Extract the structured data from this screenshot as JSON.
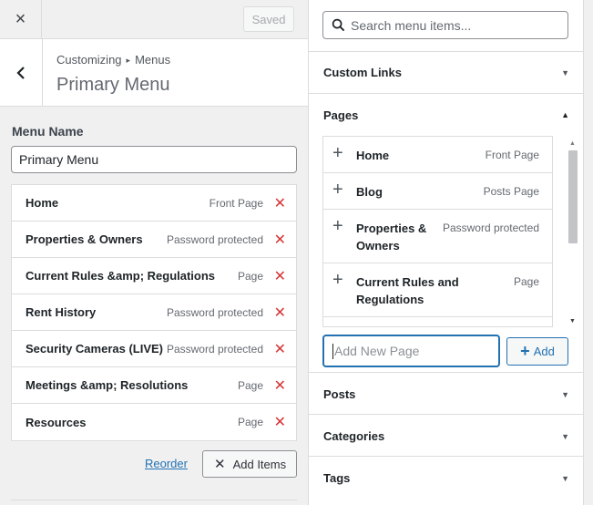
{
  "topbar": {
    "close_icon": "×",
    "saved_label": "Saved"
  },
  "header": {
    "breadcrumb_root": "Customizing",
    "breadcrumb_sep": "▸",
    "breadcrumb_section": "Menus",
    "title": "Primary Menu",
    "back_icon": "‹"
  },
  "menu": {
    "name_label": "Menu Name",
    "name_value": "Primary Menu",
    "items": [
      {
        "title": "Home",
        "type": "Front Page"
      },
      {
        "title": "Properties & Owners",
        "type": "Password protected"
      },
      {
        "title": "Current Rules &amp; Regulations",
        "type": "Page"
      },
      {
        "title": "Rent History",
        "type": "Password protected"
      },
      {
        "title": "Security Cameras (LIVE)",
        "type": "Password protected"
      },
      {
        "title": "Meetings &amp; Resolutions",
        "type": "Page"
      },
      {
        "title": "Resources",
        "type": "Page"
      }
    ],
    "remove_icon": "✕",
    "reorder_label": "Reorder",
    "add_items_label": "Add Items",
    "add_items_icon": "✕"
  },
  "panel": {
    "search_placeholder": "Search menu items...",
    "sections": {
      "custom_links": "Custom Links",
      "pages": "Pages",
      "posts": "Posts",
      "categories": "Categories",
      "tags": "Tags"
    },
    "caret_down": "▼",
    "caret_up": "▲",
    "pages": [
      {
        "title_line1": "Home",
        "title_line2": "",
        "type": "Front Page"
      },
      {
        "title_line1": "Blog",
        "title_line2": "",
        "type": "Posts Page"
      },
      {
        "title_line1": "Properties &",
        "title_line2": "Owners",
        "type": "Password protected"
      },
      {
        "title_line1": "Current Rules and",
        "title_line2": "Regulations",
        "type": "Page"
      }
    ],
    "plus_icon": "+",
    "new_page_placeholder": "Add New Page",
    "add_label": "Add",
    "add_icon": "+"
  },
  "colors": {
    "accent": "#2271b1",
    "danger": "#d63638",
    "border": "#dcdcde",
    "bg": "#f0f0f1"
  }
}
